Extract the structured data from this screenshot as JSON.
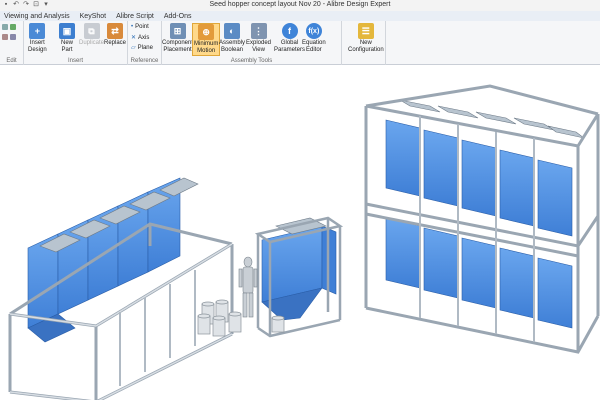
{
  "title": "Seed hopper concept layout Nov 20 - Alibre Design Expert",
  "menu": [
    "Viewing and Analysis",
    "KeyShot",
    "Alibre Script",
    "Add-Ons"
  ],
  "ribbon": {
    "groups": {
      "edit": "Edit",
      "insert": "Insert",
      "reference": "Reference",
      "assembly_tools": "Assembly Tools"
    },
    "insert_design": "Insert\nDesign",
    "new_part": "New\nPart",
    "duplicate": "Duplicate",
    "replace": "Replace",
    "point": "Point",
    "axis": "Axis",
    "plane": "Plane",
    "component_placement": "Component\nPlacement",
    "minimum_motion": "Minimum\nMotion",
    "assembly_boolean": "Assembly\nBoolean",
    "exploded_view": "Exploded\nView",
    "global_parameters": "Global\nParameters",
    "equation_editor": "Equation\nEditor",
    "new_configuration": "New\nConfiguration"
  },
  "colors": {
    "hopper_blue": "#4a8ee0",
    "frame_gray": "#c9d2da",
    "active_button": "#ffd98a"
  }
}
